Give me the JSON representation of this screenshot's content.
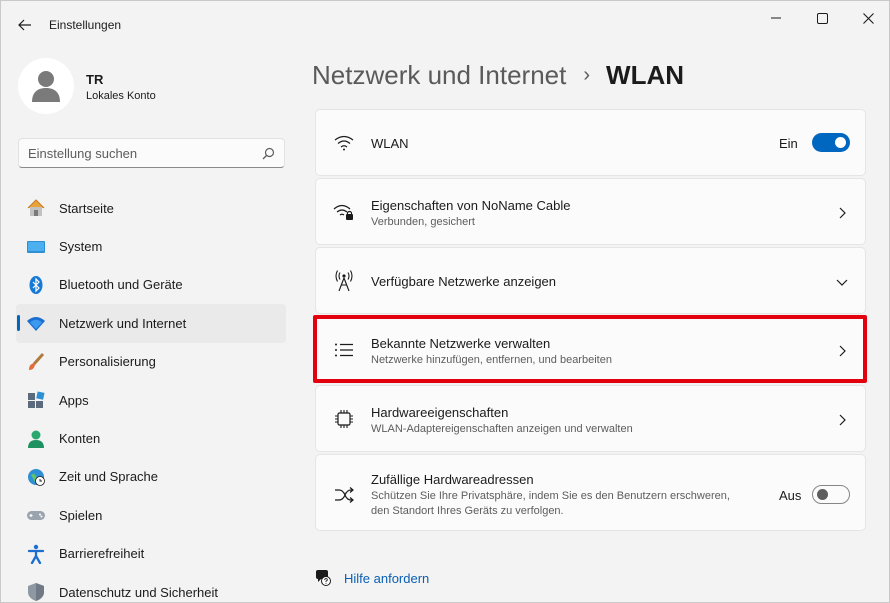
{
  "window": {
    "title": "Einstellungen"
  },
  "profile": {
    "initials": "TR",
    "account_type": "Lokales Konto"
  },
  "search": {
    "placeholder": "Einstellung suchen"
  },
  "sidebar": {
    "items": [
      {
        "label": "Startseite",
        "icon": "home-icon"
      },
      {
        "label": "System",
        "icon": "system-icon"
      },
      {
        "label": "Bluetooth und Geräte",
        "icon": "bluetooth-icon"
      },
      {
        "label": "Netzwerk und Internet",
        "icon": "wifi-icon",
        "active": true
      },
      {
        "label": "Personalisierung",
        "icon": "brush-icon"
      },
      {
        "label": "Apps",
        "icon": "apps-icon"
      },
      {
        "label": "Konten",
        "icon": "account-icon"
      },
      {
        "label": "Zeit und Sprache",
        "icon": "globe-clock-icon"
      },
      {
        "label": "Spielen",
        "icon": "gamepad-icon"
      },
      {
        "label": "Barrierefreiheit",
        "icon": "accessibility-icon"
      },
      {
        "label": "Datenschutz und Sicherheit",
        "icon": "shield-icon"
      }
    ]
  },
  "breadcrumb": {
    "parent": "Netzwerk und Internet",
    "separator": "›",
    "current": "WLAN"
  },
  "cards": {
    "wlan": {
      "title": "WLAN",
      "toggle_label": "Ein",
      "toggle_on": true
    },
    "properties": {
      "title": "Eigenschaften von NoName Cable",
      "subtitle": "Verbunden, gesichert"
    },
    "available": {
      "title": "Verfügbare Netzwerke anzeigen"
    },
    "known": {
      "title": "Bekannte Netzwerke verwalten",
      "subtitle": "Netzwerke hinzufügen, entfernen, und bearbeiten"
    },
    "hardware": {
      "title": "Hardwareeigenschaften",
      "subtitle": "WLAN-Adaptereigenschaften anzeigen und verwalten"
    },
    "random": {
      "title": "Zufällige Hardwareadressen",
      "subtitle": "Schützen Sie Ihre Privatsphäre, indem Sie es den Benutzern erschweren, den Standort Ihres Geräts zu verfolgen.",
      "toggle_label": "Aus",
      "toggle_on": false
    }
  },
  "help": {
    "label": "Hilfe anfordern"
  },
  "colors": {
    "accent": "#0067c0",
    "highlight": "#e3000f"
  }
}
